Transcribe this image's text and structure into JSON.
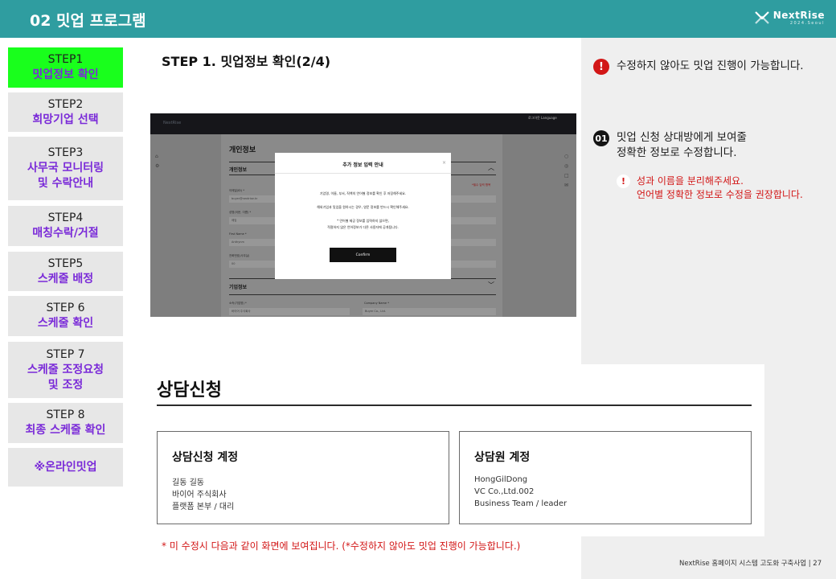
{
  "header": {
    "title": "02 밋업 프로그램",
    "brand_name": "NextRise",
    "brand_sub": "2024.Seoul"
  },
  "sidebar": {
    "items": [
      {
        "num": "STEP1",
        "label": "밋업정보 확인",
        "active": true
      },
      {
        "num": "STEP2",
        "label": "희망기업 선택"
      },
      {
        "num": "STEP3",
        "label": "사무국 모니터링",
        "label2": "및 수락안내"
      },
      {
        "num": "STEP4",
        "label": "매칭수락/거절"
      },
      {
        "num": "STEP5",
        "label": "스케줄 배정"
      },
      {
        "num": "STEP 6",
        "label": "스케줄 확인"
      },
      {
        "num": "STEP 7",
        "label": "스케줄 조정요청",
        "label2": "및 조정"
      },
      {
        "num": "STEP 8",
        "label": "최종 스케줄 확인"
      },
      {
        "num": "",
        "label": "※온라인밋업"
      }
    ]
  },
  "main": {
    "step_title": "STEP 1.  밋업정보 확인(2/4)"
  },
  "screenshot": {
    "nav_logo": "NextRise",
    "nav_links": "로그아웃   Language",
    "section_title": "개인정보",
    "subsection": "개인정보",
    "required_note": "*필수 입력 항목",
    "labels": [
      "이메일(ID) *",
      "성명(국문, 이름) *",
      "First Name *",
      "전화번호(사무실)"
    ],
    "values": [
      "buyer@nextrise.kr",
      "제임",
      "Anthynm",
      "00"
    ],
    "company_section": "기업정보",
    "company_label_ko": "소속(기업명) *",
    "company_label_en": "Company Name *",
    "company_value_ko": "바이어 주식회사",
    "company_value_en": "Buyer Co., Ltd.",
    "modal": {
      "title": "추가 정보 입력 안내",
      "close": "×",
      "lines": [
        "기업명, 이름, 부서, 직책의 언어별 정보를 확인 후 저장해주세요.",
        "해외기업과 밋업을 원하시는 경우, 영문 정보를 반드시 확인해주세요.",
        "* 언어별 제공 정보를 입력하지 않으면,",
        "적절하지 않은 언어정보가 다른 사용자에 공개됩니다."
      ],
      "confirm": "Confirm"
    }
  },
  "notes": {
    "warning_icon": "!",
    "warning": "수정하지 않아도 밋업 진행이 가능합니다.",
    "num_icon": "01",
    "num_line1": "밋업 신청 상대방에게 보여줄",
    "num_line2": "정확한 정보로 수정합니다.",
    "sub_icon": "!",
    "sub_line1": "성과 이름을 분리해주세요.",
    "sub_line2": "언어별 정확한 정보로 수정을 권장합니다."
  },
  "consult": {
    "title": "상담신청",
    "left_card": {
      "title": "상담신청 계정",
      "lines": [
        "길동 길동",
        "바이어 주식회사",
        "플랫폼 본부 / 대리"
      ]
    },
    "right_card": {
      "title": "상담원 계정",
      "lines": [
        "HongGilDong",
        "VC Co.,Ltd.002",
        "Business Team / leader"
      ]
    }
  },
  "footnote": "* 미 수정시 다음과 같이 화면에 보여집니다. (*수정하지 않아도 밋업 진행이 가능합니다.)",
  "page_info": "NextRise 홈페이지 시스템 고도화 구축사업  |  27"
}
